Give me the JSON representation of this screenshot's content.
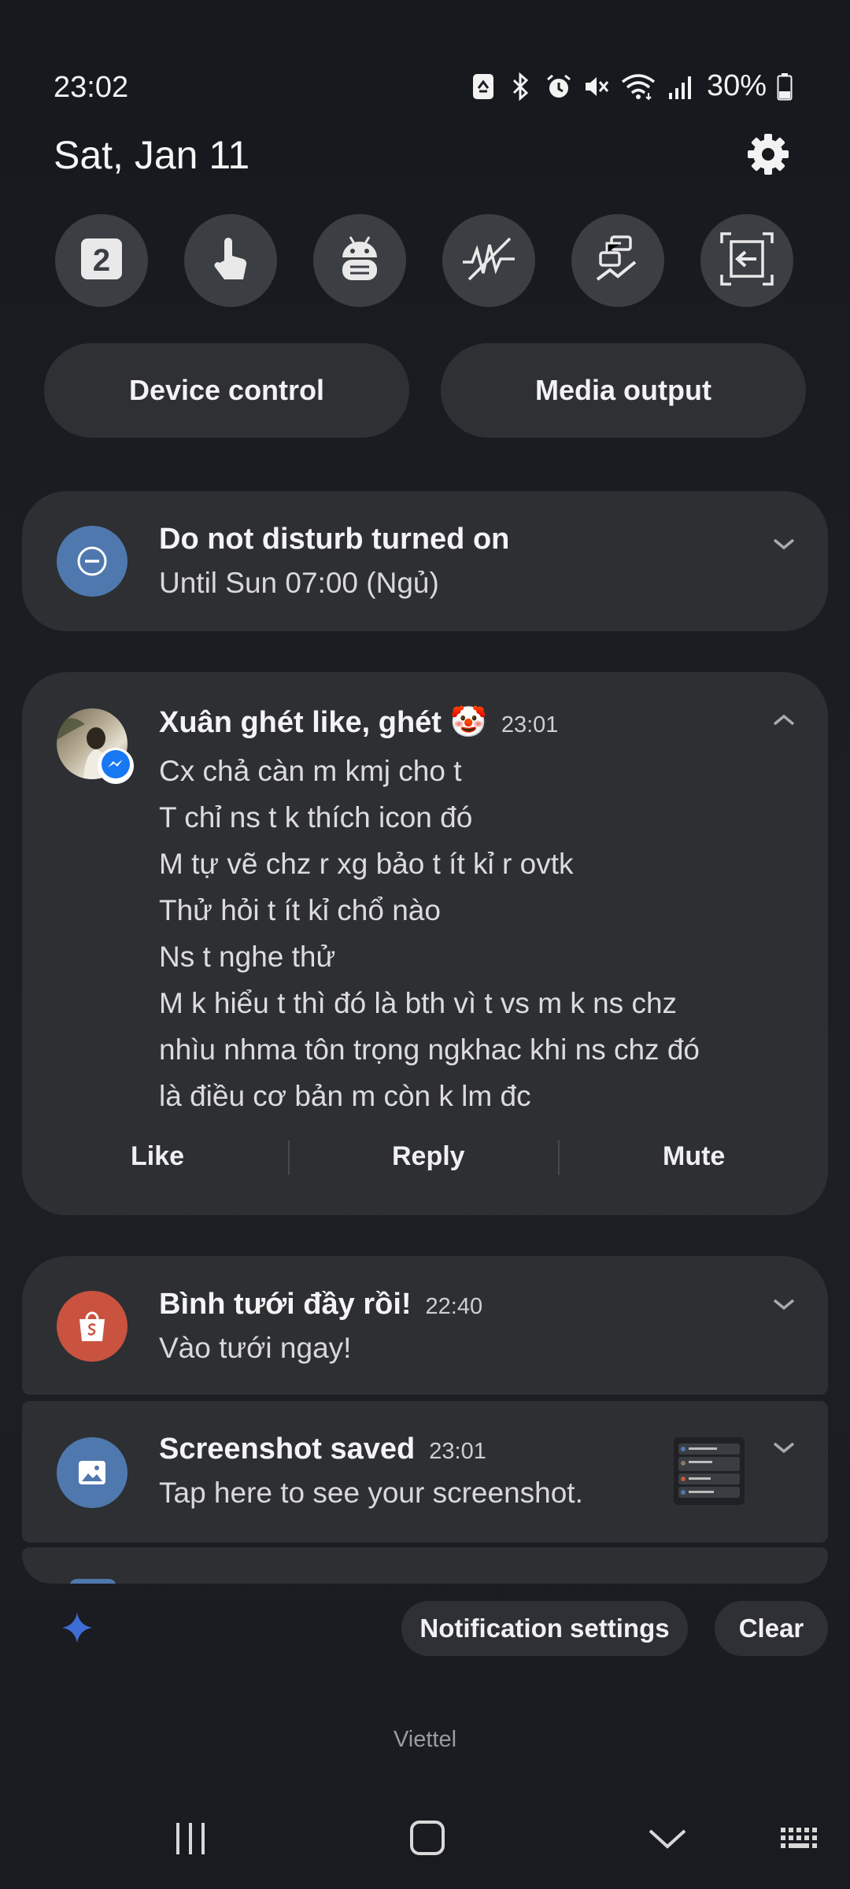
{
  "status_bar": {
    "time": "23:02",
    "battery_percent": "30%",
    "icons": [
      "recycle-icon",
      "bluetooth-icon",
      "alarm-icon",
      "mute-icon",
      "wifi-icon",
      "signal-icon",
      "battery-icon"
    ]
  },
  "header": {
    "date": "Sat, Jan 11",
    "settings_icon": "gear-icon"
  },
  "quick_toggles": [
    {
      "icon": "dual-sim-2-icon"
    },
    {
      "icon": "touch-icon"
    },
    {
      "icon": "android-debug-icon"
    },
    {
      "icon": "signal-off-icon"
    },
    {
      "icon": "routines-icon"
    },
    {
      "icon": "screen-back-icon"
    }
  ],
  "panels": {
    "device_control": "Device control",
    "media_output": "Media output"
  },
  "dnd": {
    "title": "Do not disturb turned on",
    "subtitle": "Until Sun 07:00 (Ngủ)"
  },
  "message": {
    "sender": "Xuân ghét like, ghét 🤡",
    "time": "23:01",
    "lines": [
      "Cx chả càn m kmj cho t",
      "T chỉ ns t k thích icon đó",
      "M tự vẽ chz r xg bảo t ít kỉ r ovtk",
      "Thử hỏi t ít kỉ chổ nào",
      "Ns t nghe thử",
      "M k hiểu t thì đó là bth vì t vs m k ns chz",
      "nhìu nhma tôn trọng ngkhac khi ns chz đó",
      "là điều cơ bản m còn k lm đc"
    ],
    "actions": {
      "like": "Like",
      "reply": "Reply",
      "mute": "Mute"
    }
  },
  "shopee": {
    "title": "Bình tưới đầy rồi!",
    "time": "22:40",
    "subtitle": "Vào tưới ngay!"
  },
  "screenshot": {
    "title": "Screenshot saved",
    "time": "23:01",
    "subtitle": "Tap here to see your screenshot."
  },
  "footer": {
    "notification_settings": "Notification settings",
    "clear": "Clear",
    "carrier": "Viettel"
  },
  "colors": {
    "dnd_badge": "#4f78ae",
    "shopee_badge": "#c9533f",
    "screenshot_badge": "#4f78ae",
    "messenger_badge": "#1877f2",
    "sparkle": "#3f6dd6"
  }
}
